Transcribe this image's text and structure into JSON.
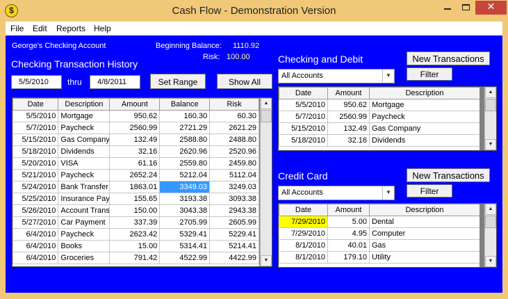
{
  "window": {
    "title": "Cash Flow - Demonstration Version",
    "icon_letter": "$",
    "close_glyph": "✕"
  },
  "menu": [
    "File",
    "Edit",
    "Reports",
    "Help"
  ],
  "account": {
    "name": "George's Checking Account",
    "beginning_balance_label": "Beginning Balance:",
    "beginning_balance": "1110.92",
    "risk_label": "Risk:",
    "risk": "100.00"
  },
  "history": {
    "title": "Checking Transaction History",
    "from_date": "5/5/2010",
    "thru_label": "thru",
    "to_date": "4/8/2011",
    "set_range_label": "Set Range",
    "show_all_label": "Show All",
    "columns": [
      "Date",
      "Description",
      "Amount",
      "Balance",
      "Risk"
    ],
    "rows": [
      [
        "5/5/2010",
        "Mortgage",
        "950.62",
        "160.30",
        "60.30"
      ],
      [
        "5/7/2010",
        "Paycheck",
        "2560.99",
        "2721.29",
        "2621.29"
      ],
      [
        "5/15/2010",
        "Gas Company",
        "132.49",
        "2588.80",
        "2488.80"
      ],
      [
        "5/18/2010",
        "Dividends",
        "32.16",
        "2620.96",
        "2520.96"
      ],
      [
        "5/20/2010",
        "VISA",
        "61.16",
        "2559.80",
        "2459.80"
      ],
      [
        "5/21/2010",
        "Paycheck",
        "2652.24",
        "5212.04",
        "5112.04"
      ],
      [
        "5/24/2010",
        "Bank Transfer",
        "1863.01",
        "3349.03",
        "3249.03"
      ],
      [
        "5/25/2010",
        "Insurance Pay",
        "155.65",
        "3193.38",
        "3093.38"
      ],
      [
        "5/26/2010",
        "Account Trans",
        "150.00",
        "3043.38",
        "2943.38"
      ],
      [
        "5/27/2010",
        "Car Payment",
        "337.39",
        "2705.99",
        "2605.99"
      ],
      [
        "6/4/2010",
        "Paycheck",
        "2623.42",
        "5329.41",
        "5229.41"
      ],
      [
        "6/4/2010",
        "Books",
        "15.00",
        "5314.41",
        "5214.41"
      ],
      [
        "6/4/2010",
        "Groceries",
        "791.42",
        "4522.99",
        "4422.99"
      ]
    ],
    "selected_cell": {
      "row": 6,
      "col": 3
    }
  },
  "checking": {
    "title": "Checking and Debit",
    "new_transactions_label": "New Transactions",
    "filter_label": "Filter",
    "account_select": "All Accounts",
    "columns": [
      "Date",
      "Amount",
      "Description"
    ],
    "rows": [
      [
        "5/5/2010",
        "950.62",
        "Mortgage"
      ],
      [
        "5/7/2010",
        "2560.99",
        "Paycheck"
      ],
      [
        "5/15/2010",
        "132.49",
        "Gas Company"
      ],
      [
        "5/18/2010",
        "32.16",
        "Dividends"
      ]
    ]
  },
  "credit": {
    "title": "Credit Card",
    "new_transactions_label": "New Transactions",
    "filter_label": "Filter",
    "account_select": "All Accounts",
    "columns": [
      "Date",
      "Amount",
      "Description"
    ],
    "rows": [
      [
        "7/29/2010",
        "5.00",
        "Dental"
      ],
      [
        "7/29/2010",
        "4.95",
        "Computer"
      ],
      [
        "8/1/2010",
        "40.01",
        "Gas"
      ],
      [
        "8/1/2010",
        "179.10",
        "Utility"
      ]
    ],
    "highlighted_row": 0
  },
  "icons": {
    "dropdown": "▼",
    "scroll_up": "▲",
    "scroll_down": "▼"
  },
  "colors": {
    "background": "#0000ff",
    "selected_cell": "#3399ff",
    "highlight": "#ffff00",
    "close_button": "#c7463c",
    "titlebar": "#f0c878"
  }
}
